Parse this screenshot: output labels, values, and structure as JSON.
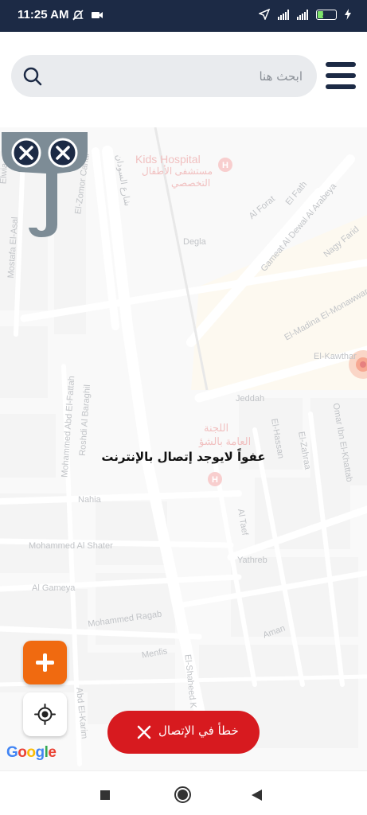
{
  "status_bar": {
    "time": "11:25 AM",
    "battery": "29",
    "left_icons": [
      "mute-icon",
      "video-icon"
    ],
    "right_icons": [
      "location-arrow-icon",
      "signal-icon",
      "signal-icon",
      "battery-icon",
      "charging-icon"
    ]
  },
  "search": {
    "placeholder": "ابحث هنا",
    "value": ""
  },
  "map": {
    "labels": [
      "Kids Hospital",
      "مستشفى الأطفال",
      "التخصصي",
      "El-Zomor Canal",
      "Degla",
      "Al Forat",
      "El Fath",
      "Gameat Al Dewal Al Arabeya",
      "Nagy Farid",
      "El-Madina El-Monawwara",
      "El-Kawthar",
      "Jeddah",
      "El-Hassan",
      "El-Zahraa",
      "Omar Ibn El-Khattab",
      "Mohammed Abd El-Fattah",
      "Roshdi Al Baraghil",
      "Nahia",
      "Al Taef",
      "Mohammed Al Shater",
      "Yathreb",
      "Al Gameya",
      "Mohammed Ragab",
      "Aman",
      "Menfis",
      "El-Shaheed K",
      "Abd El-Karim",
      "Mostafa El-Asal",
      "Elwia",
      "اللجنة",
      "العامة بالشؤ",
      "شارع السودان"
    ],
    "attribution": "Google"
  },
  "error": {
    "message": "عفواً لايوجد إتصال بالإنترنت"
  },
  "toast": {
    "message": "خطأ في الإتصال"
  },
  "colors": {
    "brand_navy": "#1c2a45",
    "accent_orange": "#f06a10",
    "error_red": "#d71a1f",
    "logo_gray": "#7d8c96"
  }
}
